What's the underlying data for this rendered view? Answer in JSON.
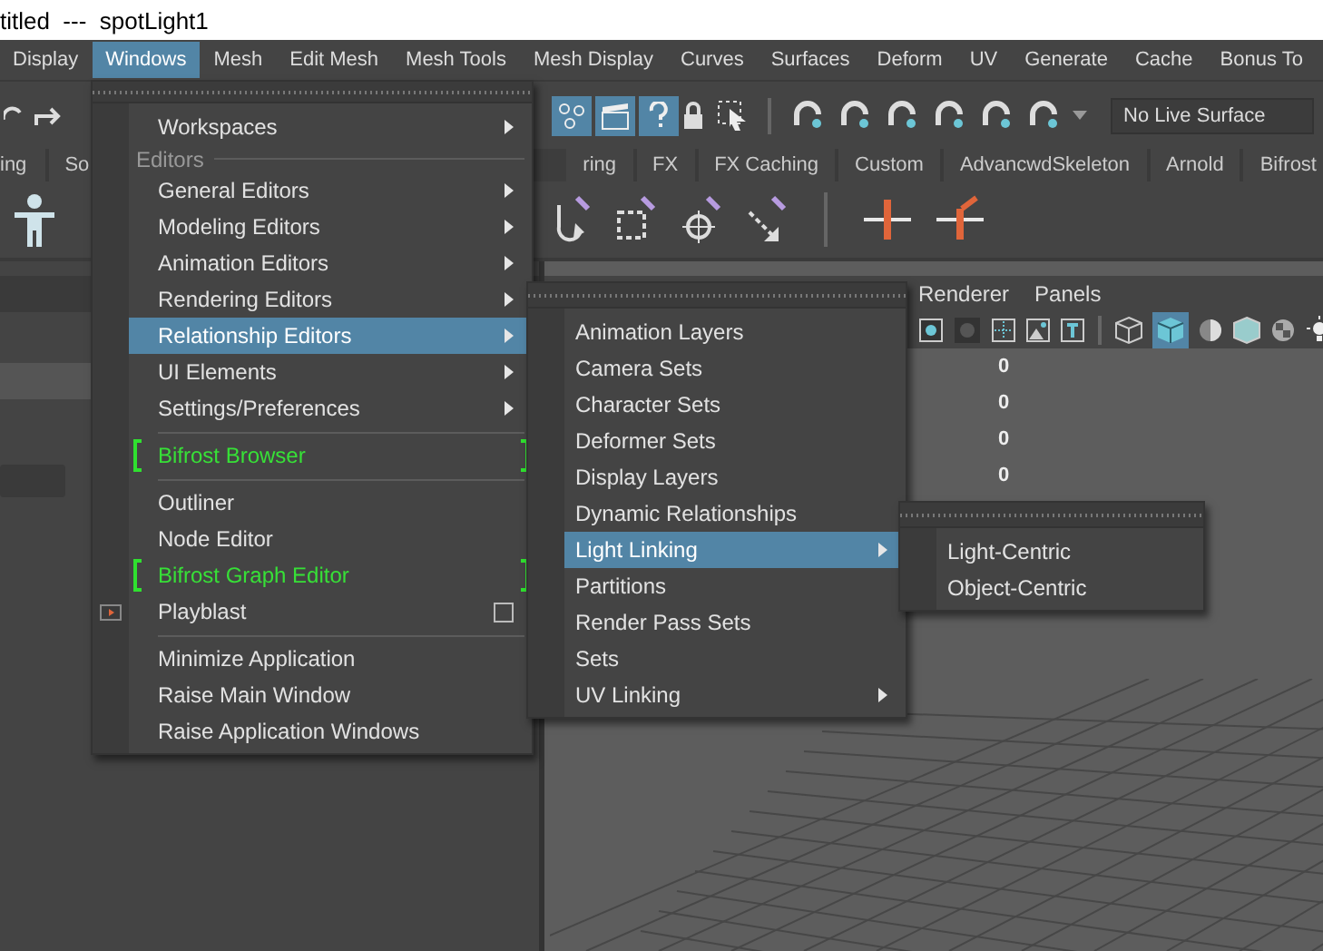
{
  "window": {
    "title": "titled  ---  spotLight1"
  },
  "menu_bar": [
    {
      "label": "Display",
      "selected": false
    },
    {
      "label": "Windows",
      "selected": true
    },
    {
      "label": "Mesh",
      "selected": false
    },
    {
      "label": "Edit Mesh",
      "selected": false
    },
    {
      "label": "Mesh Tools",
      "selected": false
    },
    {
      "label": "Mesh Display",
      "selected": false
    },
    {
      "label": "Curves",
      "selected": false
    },
    {
      "label": "Surfaces",
      "selected": false
    },
    {
      "label": "Deform",
      "selected": false
    },
    {
      "label": "UV",
      "selected": false
    },
    {
      "label": "Generate",
      "selected": false
    },
    {
      "label": "Cache",
      "selected": false
    },
    {
      "label": "Bonus To",
      "selected": false
    }
  ],
  "toolbar": {
    "live_surface": "No Live Surface"
  },
  "shelf_tabs_left": [
    "ing",
    "So"
  ],
  "shelf_tabs_right": [
    "ring",
    "FX",
    "FX Caching",
    "Custom",
    "AdvancwdSkeleton",
    "Arnold",
    "Bifrost"
  ],
  "viewport": {
    "menus": [
      "Renderer",
      "Panels"
    ],
    "readouts": [
      "0",
      "0",
      "0",
      "0"
    ]
  },
  "windows_menu": [
    {
      "kind": "submenu",
      "label": "Workspaces",
      "selected": false
    },
    {
      "kind": "header",
      "label": "Editors"
    },
    {
      "kind": "submenu",
      "label": "General Editors",
      "selected": false
    },
    {
      "kind": "submenu",
      "label": "Modeling Editors",
      "selected": false
    },
    {
      "kind": "submenu",
      "label": "Animation Editors",
      "selected": false
    },
    {
      "kind": "submenu",
      "label": "Rendering Editors",
      "selected": false
    },
    {
      "kind": "submenu",
      "label": "Relationship Editors",
      "selected": true
    },
    {
      "kind": "submenu",
      "label": "UI Elements",
      "selected": false
    },
    {
      "kind": "submenu",
      "label": "Settings/Preferences",
      "selected": false
    },
    {
      "kind": "separator"
    },
    {
      "kind": "bifrost",
      "label": "Bifrost Browser",
      "selected": false
    },
    {
      "kind": "separator"
    },
    {
      "kind": "item",
      "label": "Outliner",
      "selected": false
    },
    {
      "kind": "item",
      "label": "Node Editor",
      "selected": false
    },
    {
      "kind": "bifrost",
      "label": "Bifrost Graph Editor",
      "selected": false
    },
    {
      "kind": "option",
      "label": "Playblast",
      "selected": false
    },
    {
      "kind": "separator"
    },
    {
      "kind": "item",
      "label": "Minimize Application",
      "selected": false
    },
    {
      "kind": "item",
      "label": "Raise Main Window",
      "selected": false
    },
    {
      "kind": "item",
      "label": "Raise Application Windows",
      "selected": false
    }
  ],
  "relationship_menu": [
    {
      "kind": "item",
      "label": "Animation Layers",
      "selected": false
    },
    {
      "kind": "item",
      "label": "Camera Sets",
      "selected": false
    },
    {
      "kind": "item",
      "label": "Character Sets",
      "selected": false
    },
    {
      "kind": "item",
      "label": "Deformer Sets",
      "selected": false
    },
    {
      "kind": "item",
      "label": "Display Layers",
      "selected": false
    },
    {
      "kind": "item",
      "label": "Dynamic Relationships",
      "selected": false
    },
    {
      "kind": "submenu",
      "label": "Light Linking",
      "selected": true
    },
    {
      "kind": "item",
      "label": "Partitions",
      "selected": false
    },
    {
      "kind": "item",
      "label": "Render Pass Sets",
      "selected": false
    },
    {
      "kind": "item",
      "label": "Sets",
      "selected": false
    },
    {
      "kind": "submenu",
      "label": "UV Linking",
      "selected": false
    }
  ],
  "light_linking_menu": [
    {
      "label": "Light-Centric",
      "selected": false
    },
    {
      "label": "Object-Centric",
      "selected": false
    }
  ]
}
